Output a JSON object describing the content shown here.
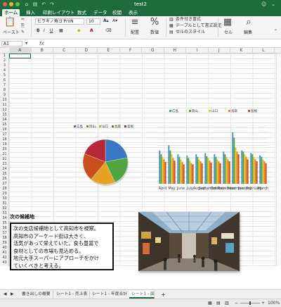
{
  "window": {
    "title": "test2"
  },
  "ribbon": {
    "tabs": [
      "ホーム",
      "挿入",
      "印刷レイアウト",
      "数式",
      "データ",
      "校閲",
      "表示"
    ],
    "paste_label": "ペースト",
    "font_name": "ヒラギノ角ゴ ProN",
    "font_size": "10",
    "align_label": "配置",
    "number_label": "数値",
    "cond_format_label": "条件付き書式",
    "table_format_label": "テーブルとして書式設定",
    "cell_style_label": "セルのスタイル",
    "cell_label": "セル",
    "edit_label": "編集"
  },
  "formula_bar": {
    "name_box": "A1",
    "fx": "fx"
  },
  "columns": [
    "A",
    "B",
    "C",
    "D",
    "E",
    "F",
    "G",
    "H",
    "I",
    "J",
    "K",
    "L"
  ],
  "rows": [
    "1",
    "2",
    "3",
    "4",
    "5",
    "6",
    "7",
    "8",
    "9",
    "10",
    "11",
    "12",
    "13",
    "14",
    "15",
    "16",
    "17",
    "18",
    "19",
    "20",
    "21",
    "22",
    "23",
    "24",
    "25",
    "26",
    "27",
    "28",
    "29",
    "30",
    "31",
    "32",
    "33",
    "34",
    "35",
    "36",
    "37",
    "38",
    "39",
    "40",
    "41",
    "42",
    "43"
  ],
  "chart_data": [
    {
      "type": "pie",
      "series_names": [
        "広島",
        "岡山",
        "山口",
        "鳥取",
        "島根"
      ],
      "colors": [
        "#3a78c3",
        "#4ea63d",
        "#e7a224",
        "#c94f1e",
        "#b5293a"
      ],
      "values": [
        22,
        21,
        18,
        20,
        19
      ]
    },
    {
      "type": "bar",
      "categories": [
        "April",
        "May",
        "June",
        "July",
        "August",
        "September",
        "October",
        "November",
        "December",
        "January",
        "February",
        "March"
      ],
      "series": [
        {
          "name": "広島",
          "color": "#4a90d9",
          "values": [
            260,
            300,
            230,
            220,
            230,
            240,
            230,
            250,
            400,
            260,
            240,
            220
          ]
        },
        {
          "name": "岡山",
          "color": "#4ea63d",
          "values": [
            230,
            260,
            210,
            200,
            210,
            215,
            210,
            230,
            360,
            250,
            230,
            210
          ]
        },
        {
          "name": "山口",
          "color": "#e7c224",
          "values": [
            210,
            230,
            190,
            180,
            190,
            200,
            190,
            210,
            280,
            230,
            210,
            190
          ]
        },
        {
          "name": "鳥取",
          "color": "#e8852a",
          "values": [
            190,
            200,
            170,
            160,
            175,
            180,
            175,
            190,
            250,
            210,
            190,
            175
          ]
        },
        {
          "name": "島根",
          "color": "#c94f1e",
          "values": [
            170,
            180,
            150,
            150,
            160,
            165,
            160,
            175,
            230,
            190,
            175,
            160
          ]
        }
      ],
      "ylim": [
        0,
        450
      ],
      "grid": true
    }
  ],
  "text": {
    "heading": "次の候補地",
    "lines": [
      "次の支店候補地として高知市を視察。",
      "高知市のアーケード街は大きく、",
      "活気があって栄えていた。食も豊富で",
      "食材としての市場も見込める。",
      "地元大手スーパーにアプローチをかけ",
      "ていくべきと考える。"
    ]
  },
  "sheets": [
    "書き出しの概要",
    "シート1 - 売上表",
    "シート1 - 年度合計",
    "シート1 - 図"
  ],
  "status": {
    "zoom": "100%"
  },
  "colors": {
    "excel_green": "#1e6c3b"
  }
}
